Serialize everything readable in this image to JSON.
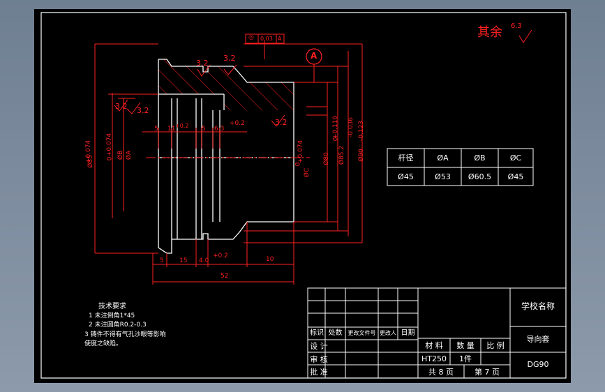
{
  "title_note": {
    "text": "其余",
    "symbol": "6.3"
  },
  "datum": "A",
  "geo_tolerance": {
    "sym": "◎",
    "value": "0.03",
    "datum": "A"
  },
  "roughness": {
    "r1": "3.2",
    "r2": "3.2",
    "r3": "3.2",
    "r4": "3.2",
    "r5": "3.2"
  },
  "dims": {
    "d_left_tol": "+0.074",
    "d_left_tol2": "0",
    "d_left_lbl": "Ø85",
    "d_b_tol": "+0.074",
    "d_b_tol2": "0",
    "d_b_lbl": "ØB",
    "d_a_lbl": "ØA",
    "d_c_tol": "+0.074",
    "d_c_tol2": "0",
    "d_c_lbl": "ØC",
    "d80": "Ø80",
    "d85_tol": "+0.110",
    "d85_tol2": "0",
    "d85": "Ø85.2",
    "d90_tol": "-0.036",
    "d90_tol2": "-0.123",
    "d90": "Ø90",
    "top_5a": "5",
    "top_11": "11",
    "top_02a": "+0.2",
    "top_5b": "5",
    "top_63": "6.3",
    "top_02b": "+0.2",
    "bot_5": "5",
    "bot_15": "15",
    "bot_4": "4.0",
    "bot_02": "+0.2",
    "bot_10": "10",
    "bot_52": "52"
  },
  "param_table": {
    "headers": [
      "杆径",
      "ØA",
      "ØB",
      "ØC"
    ],
    "row": [
      "Ø45",
      "Ø53",
      "Ø60.5",
      "Ø45"
    ]
  },
  "tech_req": {
    "title": "技术要求",
    "l1": "1  未注倒角1*45",
    "l2": "2 未注圆角R0.2-0.3",
    "l3": "3  铸件不得有气孔沙眼等影响",
    "l4": "使度之缺陷。"
  },
  "title_block": {
    "school": "学校名称",
    "part": "导向套",
    "code": "DG90",
    "rev_a": "标识",
    "rev_b": "处数",
    "rev_c": "更改文件号",
    "rev_d": "更改人",
    "rev_e": "日期",
    "design": "设 计",
    "check": "审 核",
    "approve": "批 准",
    "material_h": "材 料",
    "qty_h": "数 量",
    "scale_h": "比 例",
    "material": "HT250",
    "qty": "1件",
    "total": "共 8 页",
    "page": "第 7 页"
  }
}
